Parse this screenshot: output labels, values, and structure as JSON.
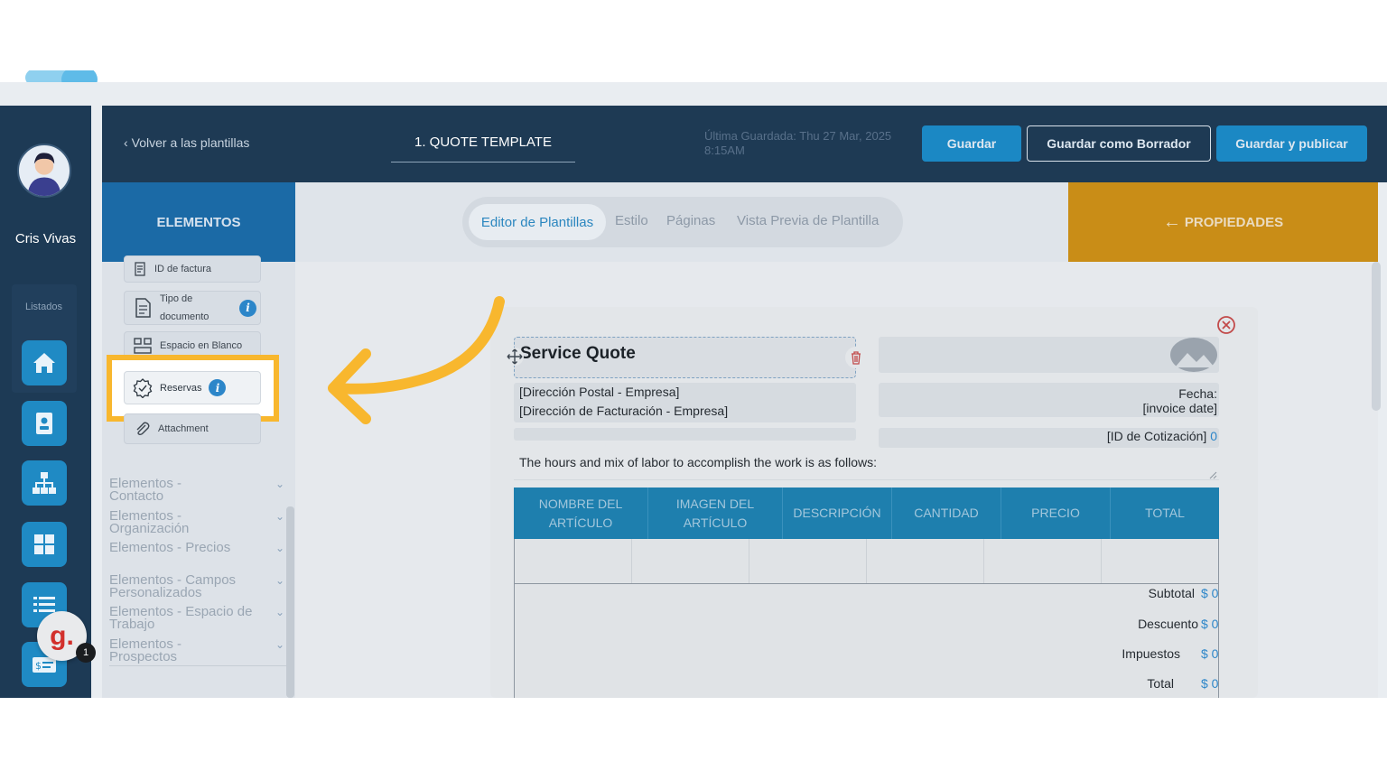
{
  "user": {
    "name": "Cris Vivas"
  },
  "rail": {
    "section_label": "Listados"
  },
  "header": {
    "back_label": "Volver a las plantillas",
    "template_name": "1. QUOTE TEMPLATE",
    "last_saved": "Última Guardada: Thu 27 Mar, 2025 8:15AM",
    "save_label": "Guardar",
    "draft_label": "Guardar como Borrador",
    "publish_label": "Guardar y publicar"
  },
  "elements_panel": {
    "title": "ELEMENTOS",
    "cards": [
      {
        "label": "ID de factura"
      },
      {
        "label": "Tipo de documento"
      },
      {
        "label": "Espacio en Blanco"
      },
      {
        "label": "Reservas"
      },
      {
        "label": "Attachment"
      }
    ],
    "sections": [
      {
        "label": "Elementos - Contacto"
      },
      {
        "label": "Elementos - Organización"
      },
      {
        "label": "Elementos - Precios"
      },
      {
        "label": "Elementos - Campos Personalizados"
      },
      {
        "label": "Elementos - Espacio de Trabajo"
      },
      {
        "label": "Elementos - Prospectos"
      }
    ]
  },
  "tabs": [
    "Editor de Plantillas",
    "Estilo",
    "Páginas",
    "Vista Previa de Plantilla"
  ],
  "properties": {
    "title": "PROPIEDADES"
  },
  "document": {
    "title": "Service Quote",
    "address_postal": "[Dirección Postal - Empresa]",
    "address_billing": "[Dirección de Facturación - Empresa]",
    "date_label": "Fecha:",
    "date_value": "[invoice date]",
    "quote_id_label": "[ID de Cotización]",
    "quote_id_value": "0",
    "labor_text": "The hours and mix of labor to accomplish the work is as follows:",
    "table_headers": [
      "NOMBRE DEL ARTÍCULO",
      "IMAGEN DEL ARTÍCULO",
      "DESCRIPCIÓN",
      "CANTIDAD",
      "PRECIO",
      "TOTAL"
    ],
    "totals": [
      {
        "label": "Subtotal",
        "value": "$ 0"
      },
      {
        "label": "Descuento",
        "value": "$ 0"
      },
      {
        "label": "Impuestos",
        "value": "$ 0"
      },
      {
        "label": "Total",
        "value": "$ 0"
      }
    ]
  },
  "chat": {
    "logo": "g.",
    "badge": "1"
  },
  "colors": {
    "accent": "#1b88c4",
    "highlight": "#f8b72e",
    "navy": "#1e3a54",
    "properties": "#c98d17"
  }
}
